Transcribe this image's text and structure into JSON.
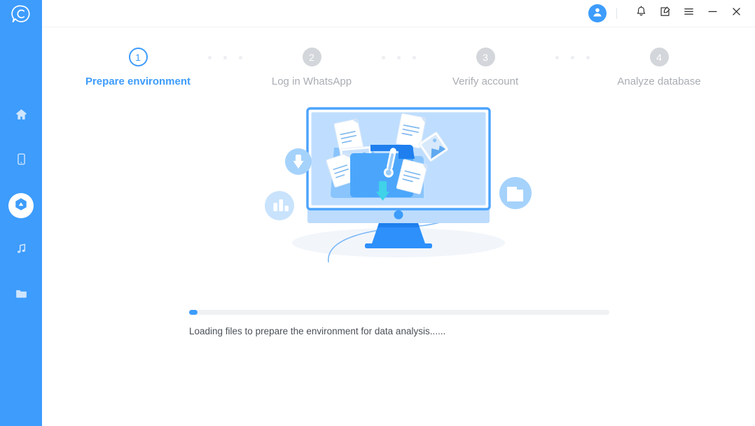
{
  "app": {
    "logo_icon": "chat-bubble-c-logo",
    "brand_color": "#3d9cfc",
    "background": "#ffffff"
  },
  "sidebar": {
    "background": "#3d9cfc",
    "items": [
      {
        "icon": "home-icon",
        "name": "home",
        "active": false
      },
      {
        "icon": "mobile-device-icon",
        "name": "device",
        "active": false
      },
      {
        "icon": "recover-droplet-icon",
        "name": "recover",
        "active": true
      },
      {
        "icon": "music-note-icon",
        "name": "music",
        "active": false
      },
      {
        "icon": "folder-icon",
        "name": "files",
        "active": false
      }
    ]
  },
  "titlebar": {
    "avatar_icon": "user-avatar-icon",
    "buttons": [
      {
        "icon": "bell-icon",
        "name": "notifications"
      },
      {
        "icon": "edit-note-icon",
        "name": "feedback"
      },
      {
        "icon": "hamburger-menu-icon",
        "name": "menu"
      },
      {
        "icon": "minimize-icon",
        "name": "minimize"
      },
      {
        "icon": "close-icon",
        "name": "close"
      }
    ]
  },
  "stepper": {
    "active_index": 0,
    "active_color": "#3d9cfc",
    "inactive_color": "#d3d6da",
    "steps": [
      {
        "number": "1",
        "label": "Prepare environment"
      },
      {
        "number": "2",
        "label": "Log in WhatsApp"
      },
      {
        "number": "3",
        "label": "Verify account"
      },
      {
        "number": "4",
        "label": "Analyze database"
      }
    ]
  },
  "illustration": {
    "name": "monitor-file-transfer-illustration",
    "badges": [
      {
        "name": "download-badge",
        "icon": "download-arrow-icon"
      },
      {
        "name": "chart-badge",
        "icon": "bar-chart-icon"
      },
      {
        "name": "media-badge",
        "icon": "video-folder-icon"
      }
    ]
  },
  "progress": {
    "percent": 2,
    "fill_color": "#3d9cfc",
    "track_color": "#f0f1f3",
    "status_text": "Loading files to prepare the environment for data analysis......"
  }
}
